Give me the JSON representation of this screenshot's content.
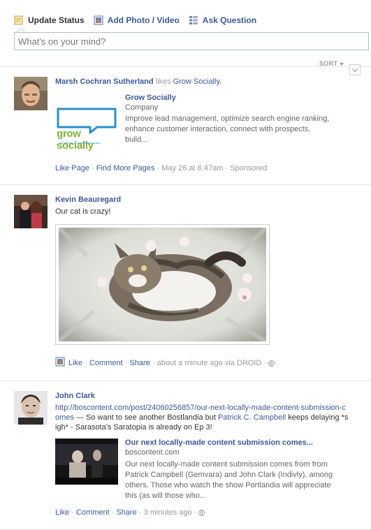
{
  "composer": {
    "tabs": [
      {
        "label": "Update Status",
        "icon": "status-pencil-icon"
      },
      {
        "label": "Add Photo / Video",
        "icon": "photo-icon"
      },
      {
        "label": "Ask Question",
        "icon": "question-list-icon"
      }
    ],
    "placeholder": "What's on your mind?"
  },
  "sort": {
    "label": "SORT"
  },
  "stories": [
    {
      "actor": "Marsh Cochran Sutherland",
      "verb": " likes ",
      "object": "Grow Socially",
      "object_tail": ".",
      "attachment": {
        "logo_text": "grow socially",
        "logo_tagline": "conversations build relationships",
        "title": "Grow Socially",
        "subtitle": "Company",
        "description": "Improve lead management, optimize search engine ranking, enhance customer interaction, connect with prospects, build..."
      },
      "footer": {
        "like": "Like Page",
        "more": "Find More Pages",
        "time": "May 26 at 6:47am",
        "sponsored": "Sponsored"
      }
    },
    {
      "actor": "Kevin Beauregard",
      "message": "Our cat is crazy!",
      "footer": {
        "like": "Like",
        "comment": "Comment",
        "share": "Share",
        "time": "about a minute ago via DROID"
      }
    },
    {
      "actor": "John Clark",
      "link_text": "http://boscontent.com/post/24060256857/our-next-locally-made-content-submission-comes",
      "message_mid": " --- So want to see another Bostlandia but ",
      "mention": "Patrick C. Campbell",
      "message_end": " keeps delaying *sigh* - Sarasota's Saratopia is already on Ep 3!",
      "attachment": {
        "title": "Our next locally-made content submission comes...",
        "subtitle": "boscontent.com",
        "description": "Our next locally-made content submission comes from from Patrick Campbell (Gemvara) and John Clark (Indivly), among others. Those who watch the show Portlandia will appreciate this (as will those who..."
      },
      "footer": {
        "like": "Like",
        "comment": "Comment",
        "share": "Share",
        "time": "3 minutes ago"
      }
    }
  ],
  "colors": {
    "link": "#3b5998",
    "meta": "#999999",
    "logo_blue": "#2a8fce",
    "logo_green": "#7fb339"
  }
}
